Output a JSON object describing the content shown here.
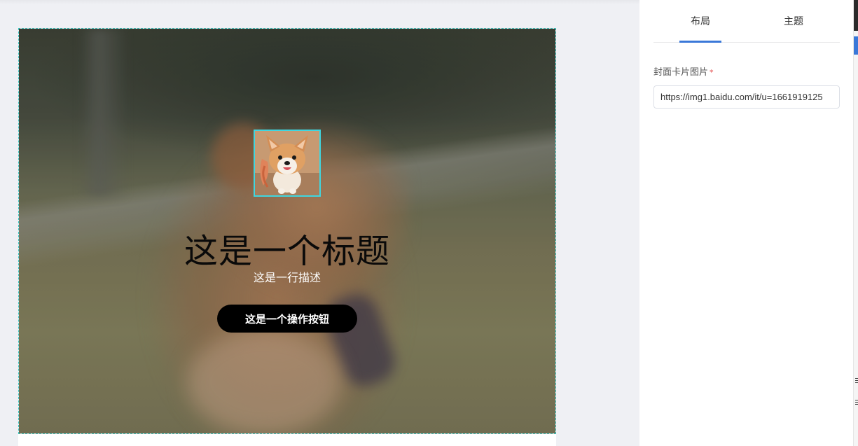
{
  "card": {
    "title": "这是一个标题",
    "description": "这是一行描述",
    "button_label": "这是一个操作按钮"
  },
  "panel": {
    "tabs": [
      {
        "label": "布局",
        "active": true
      },
      {
        "label": "主题",
        "active": false
      }
    ],
    "field": {
      "label": "封面卡片图片",
      "required_mark": "*",
      "value": "https://img1.baidu.com/it/u=1661919125"
    }
  },
  "colors": {
    "accent": "#3a78d8",
    "avatar_border": "#3fd6e0",
    "card_outline": "#3fc6c0",
    "required": "#e34c4c",
    "button_bg": "#000000"
  }
}
